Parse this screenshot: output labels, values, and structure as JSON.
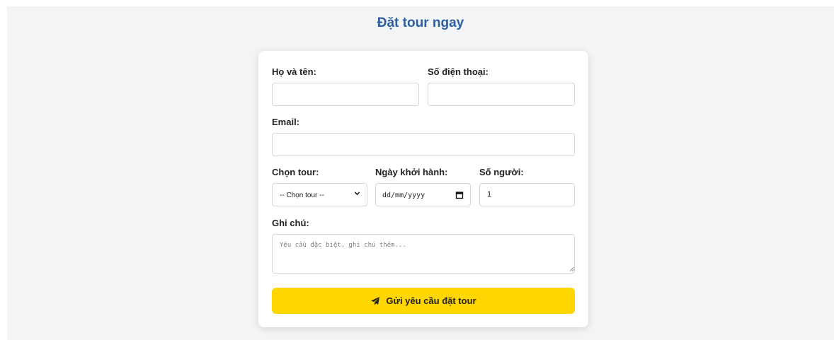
{
  "form": {
    "title": "Đặt tour ngay",
    "fields": {
      "name_label": "Họ và tên:",
      "phone_label": "Số điện thoại:",
      "email_label": "Email:",
      "tour_label": "Chọn tour:",
      "tour_selected": "-- Chọn tour --",
      "date_label": "Ngày khởi hành:",
      "date_value": "dd/mm/yyyy",
      "people_label": "Số người:",
      "people_value": "1",
      "note_label": "Ghi chú:",
      "note_placeholder": "Yêu cầu đặc biệt, ghi chú thêm..."
    },
    "submit_label": "Gửi yêu cầu đặt tour",
    "icons": {
      "submit": "paper-plane-icon",
      "select": "chevron-down-icon",
      "date": "calendar-icon"
    },
    "colors": {
      "title": "#2d5fa0",
      "button": "#ffd600",
      "background": "#f3f4f6"
    }
  }
}
